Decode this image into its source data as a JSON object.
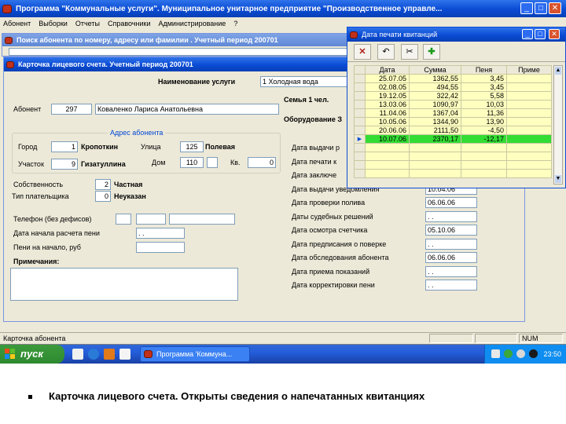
{
  "main_window": {
    "title": "Программа \"Коммунальные услуги\". Муниципальное унитарное предприятие \"Производственное управле...",
    "menu": [
      "Абонент",
      "Выборки",
      "Отчеты",
      "Справочники",
      "Администрирование",
      "?"
    ]
  },
  "search_window": {
    "title": "Поиск абонента по номеру, адресу или фамилии . Учетный период 200701"
  },
  "card_window": {
    "title": "Карточка лицевого счета. Учетный период 200701",
    "service_label": "Наименование услуги",
    "service_value": "1 Холодная вода",
    "subscriber_label": "Абонент",
    "subscriber_id": "297",
    "subscriber_name": "Коваленко Лариса Анатольевна",
    "family_label": "Семья 1 чел.",
    "equipment_label": "Оборудование З",
    "address_group": "Адрес абонента",
    "city_label": "Город",
    "city_code": "1",
    "city_name": "Кропоткин",
    "street_label": "Улица",
    "street_code": "125",
    "street_name": "Полевая",
    "district_label": "Участок",
    "district_code": "9",
    "district_name": "Гизатуллина",
    "house_label": "Дом",
    "house_value": "110",
    "apt_label": "Кв.",
    "apt_value": "0",
    "ownership_label": "Собственность",
    "ownership_code": "2",
    "ownership_value": "Частная",
    "payer_label": "Тип плательщика",
    "payer_code": "0",
    "payer_value": "Неуказан",
    "phone_label": "Телефон (без дефисов)",
    "start_date_label": "Дата начала расчета пени",
    "start_date_value": ". .",
    "penalty_label": "Пени на начало, руб",
    "notes_label": "Примечания:",
    "right_dates": [
      {
        "label": "Дата выдачи р",
        "value": ""
      },
      {
        "label": "Дата печати к",
        "value": ""
      },
      {
        "label": "Дата заключе",
        "value": ""
      },
      {
        "label": "Дата выдачи уведомления",
        "value": "10.04.06"
      },
      {
        "label": "Дата проверки полива",
        "value": "06.06.06"
      },
      {
        "label": "Даты судебных решений",
        "value": ". ."
      },
      {
        "label": "Дата осмотра счетчика",
        "value": "05.10.06"
      },
      {
        "label": "Дата предписания о поверке",
        "value": ". ."
      },
      {
        "label": "Дата обследования абонента",
        "value": "06.06.06"
      },
      {
        "label": "Дата приема показаний",
        "value": ". ."
      },
      {
        "label": "Дата корректировки пени",
        "value": ". ."
      }
    ]
  },
  "receipts_window": {
    "title": "Дата печати квитанций",
    "columns": [
      "Дата",
      "Сумма",
      "Пеня",
      "Приме"
    ],
    "rows": [
      {
        "date": "25.07.05",
        "sum": "1362,55",
        "penalty": "3,45"
      },
      {
        "date": "02.08.05",
        "sum": "494,55",
        "penalty": "3,45"
      },
      {
        "date": "19.12.05",
        "sum": "322,42",
        "penalty": "5,58"
      },
      {
        "date": "13.03.06",
        "sum": "1090,97",
        "penalty": "10,03"
      },
      {
        "date": "11.04.06",
        "sum": "1367,04",
        "penalty": "11,36"
      },
      {
        "date": "10.05.06",
        "sum": "1344,90",
        "penalty": "13,90"
      },
      {
        "date": "20.06.06",
        "sum": "2111,50",
        "penalty": "-4,50"
      },
      {
        "date": "10.07.06",
        "sum": "2370,17",
        "penalty": "-12,17"
      }
    ]
  },
  "status_bar": {
    "text": "Карточка абонента",
    "num": "NUM"
  },
  "taskbar": {
    "start": "пуск",
    "task": "Программа 'Коммуна...",
    "clock": "23:50"
  },
  "caption": "Карточка лицевого счета. Открыты сведения о напечатанных квитанциях",
  "colors": {
    "titlebar": "#0a4bd4",
    "highlight_row": "#33dd33",
    "grid_bg": "#ffffc0",
    "desktop": "#3a6ea5"
  }
}
